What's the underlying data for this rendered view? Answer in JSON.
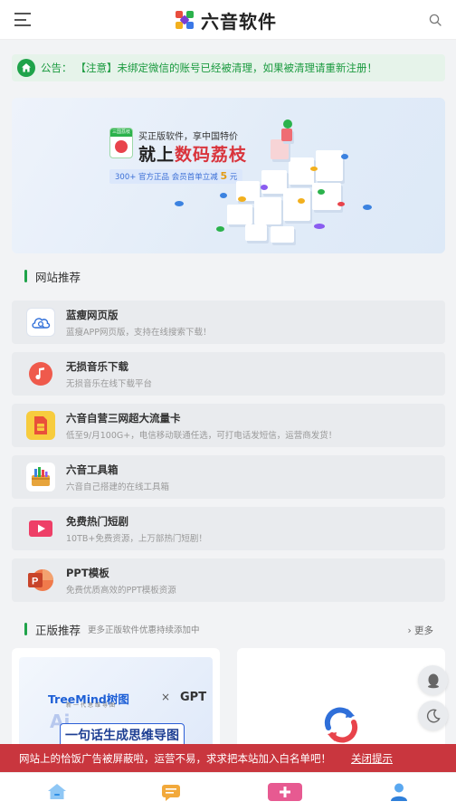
{
  "header": {
    "title": "六音软件",
    "menu_icon": "hamburger-icon",
    "search_icon": "search-icon"
  },
  "notice": {
    "icon": "home-icon",
    "label": "公告：",
    "text": "【注意】未绑定微信的账号已经被清理，如果被清理请重新注册！"
  },
  "banner": {
    "badge": "三国荔枝",
    "subtitle": "买正版软件，享中国特价",
    "headline_prefix": "就上",
    "headline_highlight": "数码荔枝",
    "tag_text": "300+ 官方正品   会员首单立减",
    "tag_number": "5",
    "tag_unit": "元"
  },
  "recommend": {
    "title": "网站推荐",
    "items": [
      {
        "title": "蓝瘦网页版",
        "desc": "蓝瘦APP网页版，支持在线搜索下载！",
        "icon": "cloud-search-icon"
      },
      {
        "title": "无损音乐下载",
        "desc": "无损音乐在线下载平台",
        "icon": "music-note-icon"
      },
      {
        "title": "六音自营三网超大流量卡",
        "desc": "低至9/月100G+，电信移动联通任选，可打电话发短信，运营商发货！",
        "icon": "sim-card-icon"
      },
      {
        "title": "六音工具箱",
        "desc": "六音自己搭建的在线工具箱",
        "icon": "toolbox-icon"
      },
      {
        "title": "免费热门短剧",
        "desc": "10TB+免费资源，上万部热门短剧！",
        "icon": "video-play-icon"
      },
      {
        "title": "PPT模板",
        "desc": "免费优质高效的PPT模板资源",
        "icon": "powerpoint-icon"
      }
    ]
  },
  "genuine": {
    "title": "正版推荐",
    "subtitle": "更多正版软件优惠持续添加中",
    "more": "更多",
    "cards": [
      {
        "brand": "TreeMind树图",
        "slogan": "新一代思维导图",
        "times": "×",
        "partner": "GPT",
        "ai": "Ai",
        "cta": "一句话生成思维导图"
      },
      {
        "icon": "sync-icon"
      }
    ]
  },
  "float_buttons": {
    "qq": "qq-icon",
    "theme": "moon-icon"
  },
  "adblock": {
    "message": "网站上的恰饭广告被屏蔽啦，运营不易，求求把本站加入白名单吧！",
    "close": "关闭提示"
  },
  "bottom_nav": {
    "items": [
      "home-icon",
      "chat-icon",
      "add-icon",
      "user-icon"
    ]
  },
  "colors": {
    "accent": "#1fa34a",
    "ad_bar": "#c9363e",
    "highlight_red": "#d9343c"
  }
}
